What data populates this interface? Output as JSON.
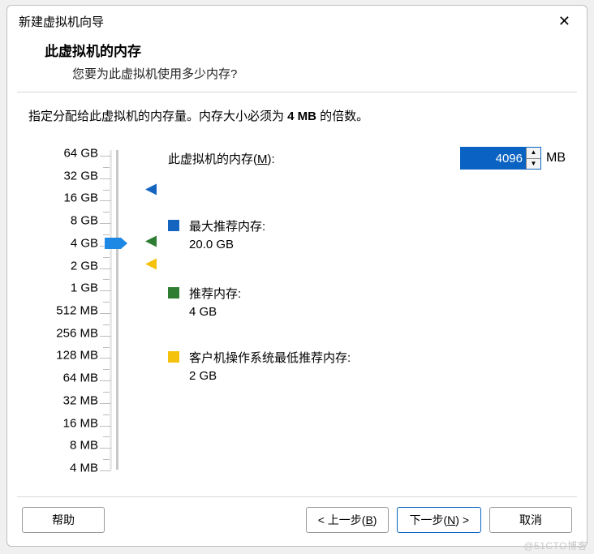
{
  "window": {
    "title": "新建虚拟机向导",
    "close_icon": "✕"
  },
  "header": {
    "title": "此虚拟机的内存",
    "subtitle": "您要为此虚拟机使用多少内存?"
  },
  "instruction": {
    "pre": "指定分配给此虚拟机的内存量。内存大小必须为 ",
    "bold": "4 MB",
    "post": " 的倍数。"
  },
  "memory": {
    "label_pre": "此虚拟机的内存(",
    "label_accel": "M",
    "label_post": "):",
    "value": "4096",
    "unit": "MB"
  },
  "slider": {
    "ticks": [
      "64 GB",
      "32 GB",
      "16 GB",
      "8 GB",
      "4 GB",
      "2 GB",
      "1 GB",
      "512 MB",
      "256 MB",
      "128 MB",
      "64 MB",
      "32 MB",
      "16 MB",
      "8 MB",
      "4 MB"
    ],
    "thumb_index": 4,
    "blue_marker_fraction": 0.12,
    "green_marker_index": 4,
    "yellow_marker_index": 5
  },
  "recommend": {
    "max": {
      "label": "最大推荐内存:",
      "value": "20.0 GB",
      "color": "#1565c0"
    },
    "sug": {
      "label": "推荐内存:",
      "value": "4 GB",
      "color": "#2e7d32"
    },
    "min": {
      "label": "客户机操作系统最低推荐内存:",
      "value": "2 GB",
      "color": "#f4c20d"
    }
  },
  "buttons": {
    "help": "帮助",
    "back_pre": "< 上一步(",
    "back_accel": "B",
    "back_post": ")",
    "next_pre": "下一步(",
    "next_accel": "N",
    "next_post": ") >",
    "cancel": "取消"
  },
  "watermark": "@51CTO博客"
}
